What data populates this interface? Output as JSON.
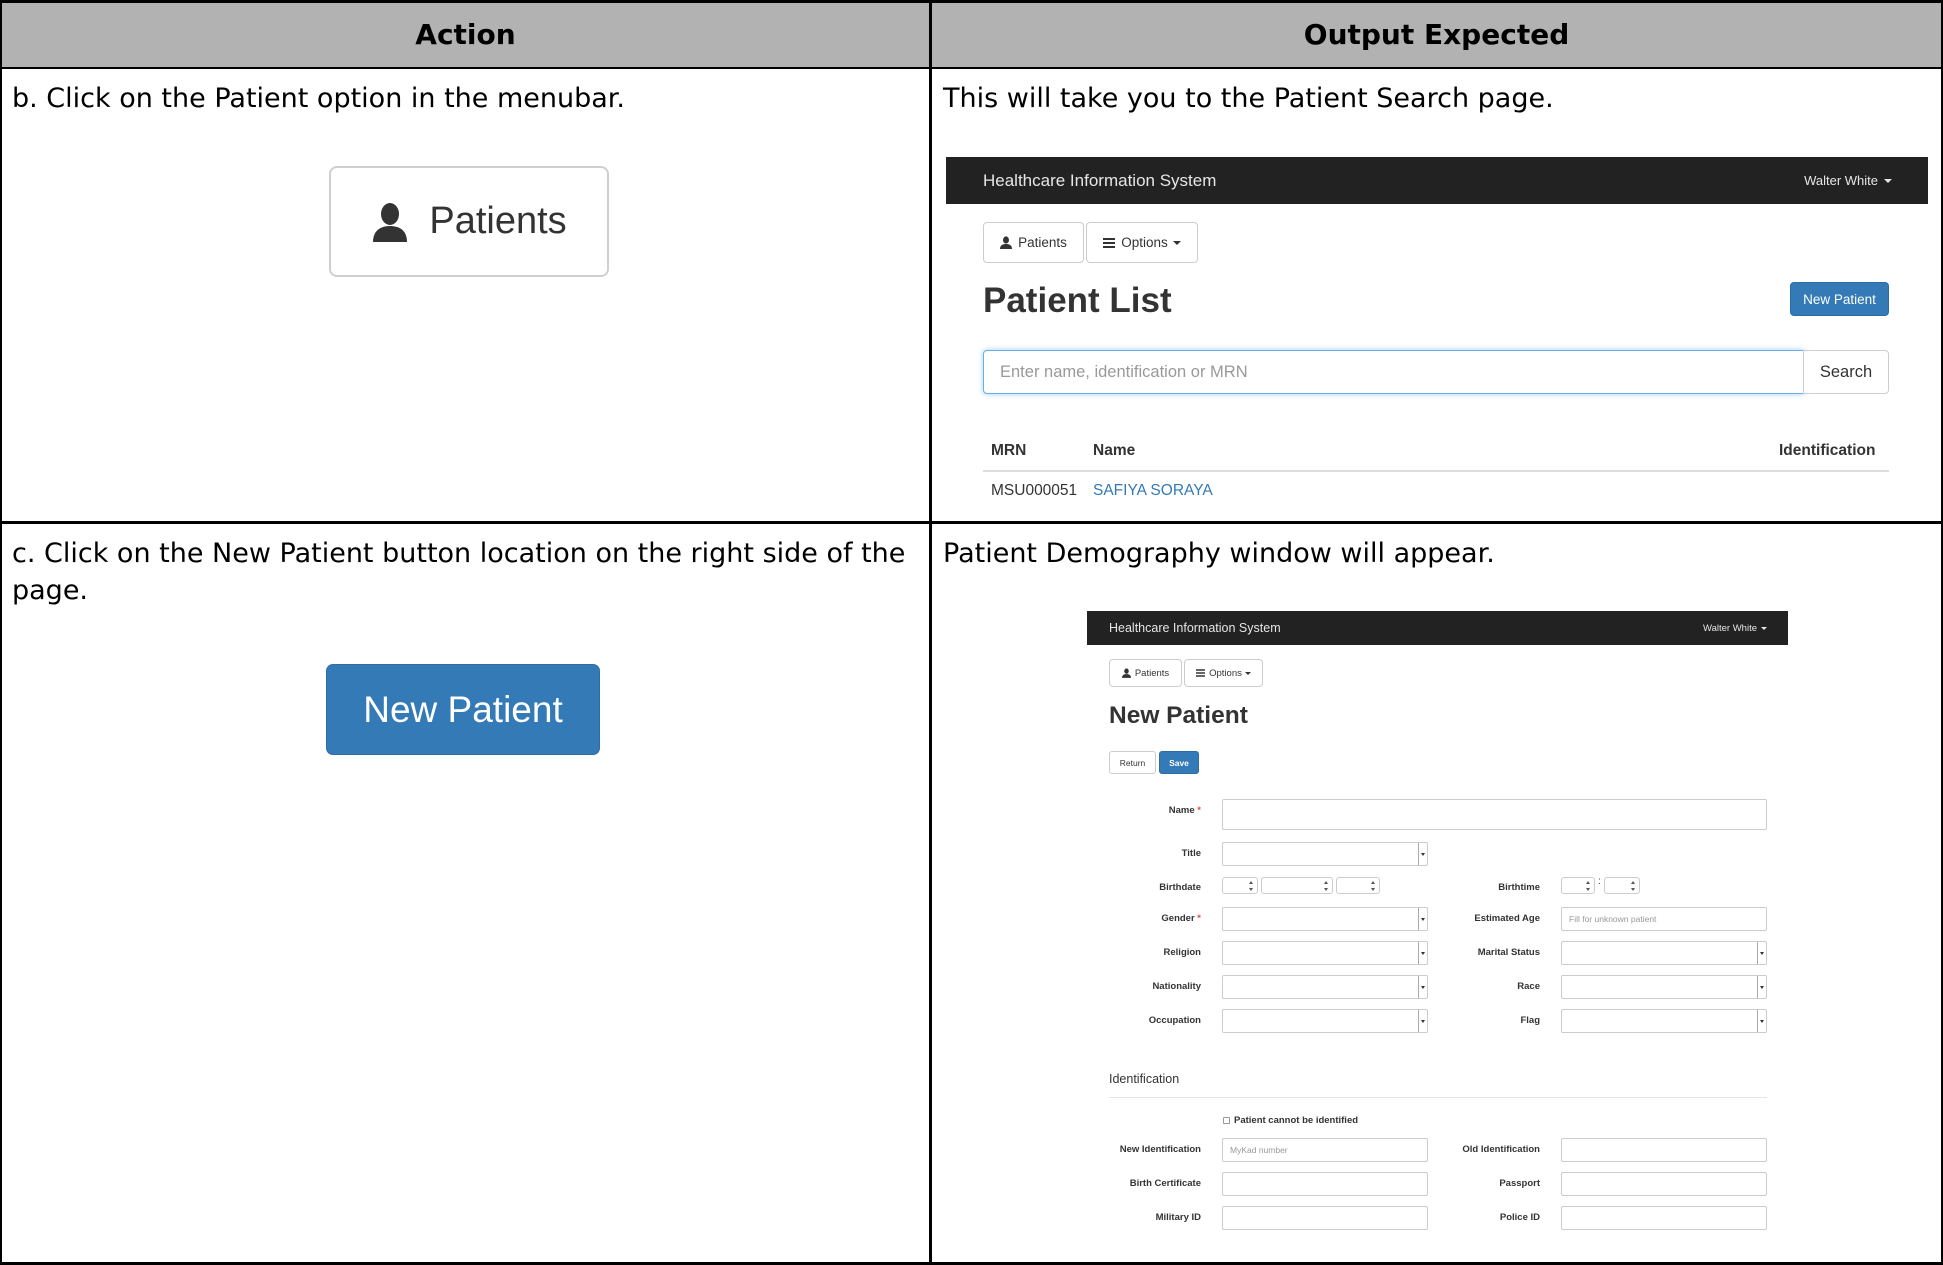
{
  "table": {
    "headers": [
      "Action",
      "Output Expected"
    ],
    "rows": [
      {
        "action": "b. Click on the Patient option in the menubar.",
        "output": "This will take you to the Patient Search page."
      },
      {
        "action_line1": "c. Click on the New Patient button location on the right side of the",
        "action_line2": "page.",
        "output": "Patient Demography window will appear."
      }
    ]
  },
  "cropped_buttons": {
    "patients_label": "Patients",
    "new_patient_label": "New Patient"
  },
  "patient_list_screen": {
    "app_title": "Healthcare Information System",
    "user": "Walter White",
    "menu": {
      "patients": "Patients",
      "options": "Options"
    },
    "page_title": "Patient List",
    "new_patient_button": "New Patient",
    "search_placeholder": "Enter name, identification or MRN",
    "search_button": "Search",
    "columns": [
      "MRN",
      "Name",
      "Identification"
    ],
    "rows": [
      {
        "mrn": "MSU000051",
        "name": "SAFIYA SORAYA",
        "identification": ""
      }
    ],
    "link_color": "#337ab7"
  },
  "new_patient_screen": {
    "app_title": "Healthcare Information System",
    "user": "Walter White",
    "menu": {
      "patients": "Patients",
      "options": "Options"
    },
    "page_title": "New Patient",
    "return_button": "Return",
    "save_button": "Save",
    "labels": {
      "name": "Name",
      "title": "Title",
      "birthdate": "Birthdate",
      "birthtime": "Birthtime",
      "gender": "Gender",
      "estimated_age": "Estimated Age",
      "religion": "Religion",
      "marital_status": "Marital Status",
      "nationality": "Nationality",
      "race": "Race",
      "occupation": "Occupation",
      "flag": "Flag",
      "identification_section": "Identification",
      "cannot_identify": "Patient cannot be identified",
      "new_identification": "New Identification",
      "old_identification": "Old Identification",
      "birth_certificate": "Birth Certificate",
      "passport": "Passport",
      "military_id": "Military ID",
      "police_id": "Police ID"
    },
    "placeholders": {
      "estimated_age": "Fill for unknown patient",
      "new_identification": "MyKad number"
    },
    "birthtime_separator": ":"
  },
  "colors": {
    "header_gray": "#b1b2b1",
    "navbar": "#222222",
    "primary": "#337ab7",
    "required": "#d9534f"
  }
}
